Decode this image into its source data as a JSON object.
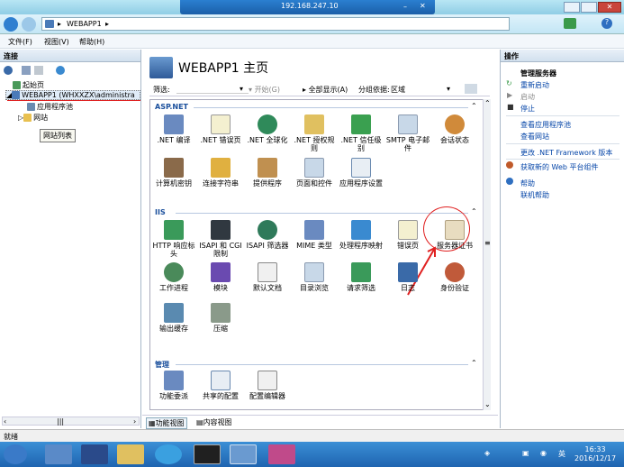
{
  "rdp": {
    "ip": "192.168.247.10"
  },
  "address": {
    "crumb": "WEBAPP1",
    "sep": "▸"
  },
  "menu": {
    "items": [
      "文件(F)",
      "视图(V)",
      "帮助(H)"
    ]
  },
  "left": {
    "header": "连接",
    "tree": [
      "起始页",
      "WEBAPP1 (WHXXZX\\administra",
      "应用程序池",
      "网站"
    ],
    "tooltip": "网站列表"
  },
  "center": {
    "title": "WEBAPP1 主页",
    "filter_label": "筛选:",
    "start_label": "开始(G)",
    "show_all": "全部显示(A)",
    "group_by": "分组依据:",
    "group_value": "区域",
    "groups": {
      "aspnet": "ASP.NET",
      "iis": "IIS",
      "mgmt": "管理"
    },
    "aspnet_items": [
      ".NET 编译",
      ".NET 错误页",
      ".NET 全球化",
      ".NET 授权规则",
      ".NET 信任级别",
      "SMTP 电子邮件",
      "会话状态",
      "计算机密钥",
      "连接字符串",
      "提供程序",
      "页面和控件",
      "应用程序设置"
    ],
    "iis_items": [
      "HTTP 响应标头",
      "ISAPI 和 CGI 限制",
      "ISAPI 筛选器",
      "MIME 类型",
      "处理程序映射",
      "错误页",
      "服务器证书",
      "工作进程",
      "模块",
      "默认文档",
      "目录浏览",
      "请求筛选",
      "日志",
      "身份验证",
      "输出缓存",
      "压缩"
    ],
    "mgmt_items": [
      "功能委派",
      "共享的配置",
      "配置编辑器"
    ],
    "tabs": [
      "功能视图",
      "内容视图"
    ]
  },
  "right": {
    "header": "操作",
    "section1": "管理服务器",
    "actions1": [
      "重新启动",
      "启动",
      "停止"
    ],
    "actions2": [
      "查看应用程序池",
      "查看网站"
    ],
    "actions3": [
      "更改 .NET Framework 版本"
    ],
    "actions4": [
      "获取新的 Web 平台组件"
    ],
    "actions5": [
      "帮助",
      "联机帮助"
    ]
  },
  "status": {
    "text": "就绪"
  },
  "clock": {
    "time": "16:33",
    "date": "2016/12/17"
  },
  "tray": {
    "lang": "英"
  },
  "colors": {
    "accent": "#1a4f9c",
    "link": "#0646a8",
    "taskbar": "#1f64b0",
    "highlight_circle": "#e02020"
  }
}
